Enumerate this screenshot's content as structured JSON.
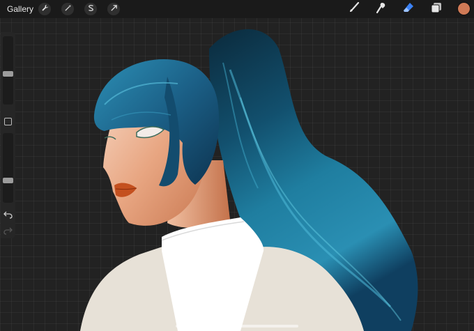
{
  "toolbar": {
    "gallery_label": "Gallery",
    "left_tools": [
      "wrench-icon",
      "magic-wand-icon",
      "selection-s-icon",
      "transform-arrow-icon"
    ],
    "right_tools": [
      "brush-icon",
      "smudge-icon",
      "eraser-icon",
      "layers-icon"
    ],
    "active_tool": "eraser-icon",
    "current_color": "#d07a56"
  },
  "sidebar": {
    "brush_size": 0.45,
    "opacity": 0.3,
    "controls": [
      "brush-size-slider",
      "modify-button",
      "opacity-slider",
      "undo-button",
      "redo-button"
    ]
  },
  "canvas": {
    "background": "#222222",
    "artwork": "woman-with-blue-ponytail-illustration"
  }
}
